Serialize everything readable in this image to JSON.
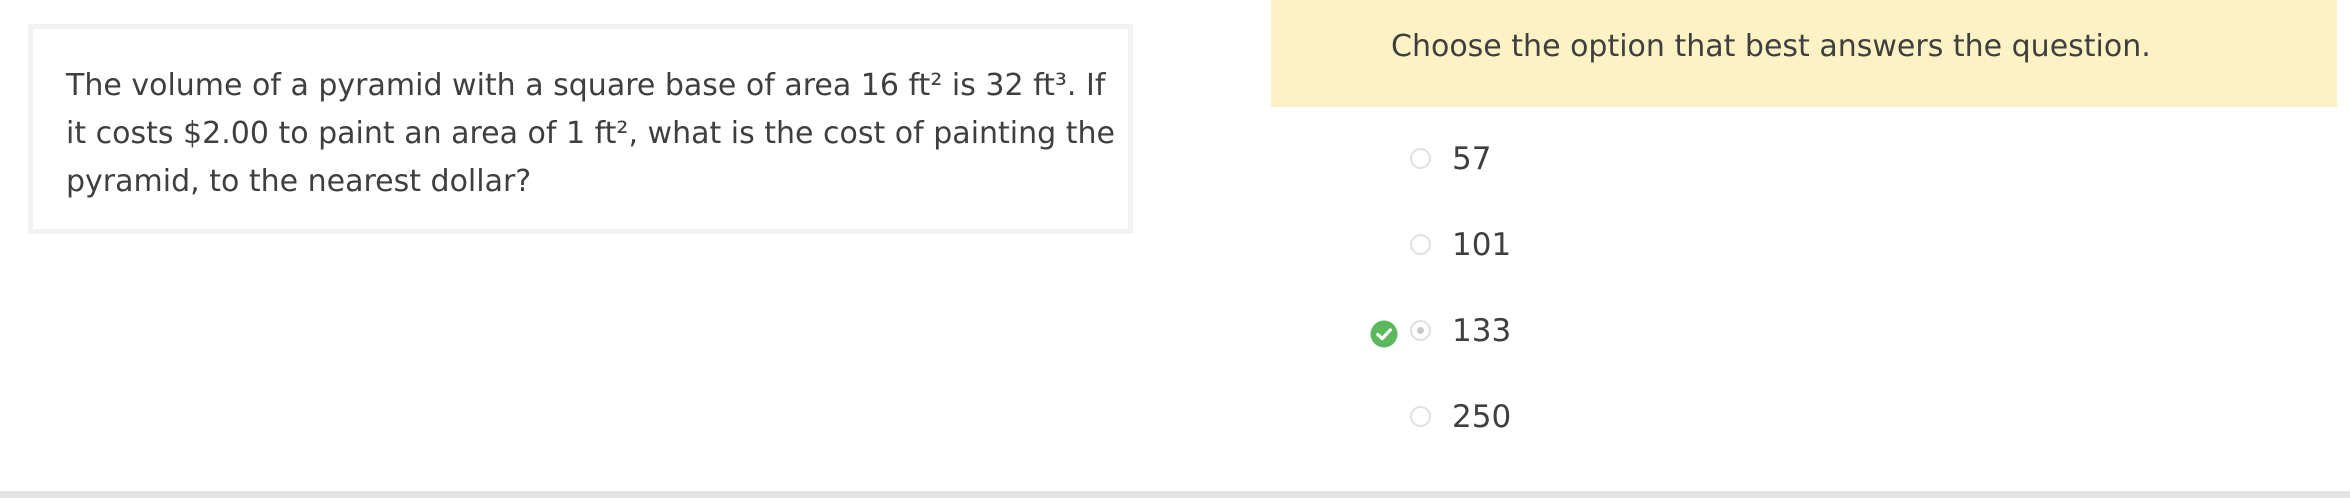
{
  "question": {
    "text": "The volume of a pyramid with a square base of area 16 ft² is 32 ft³. If it costs $2.00 to paint an area of 1 ft², what is the cost of painting the pyramid, to the nearest dollar?"
  },
  "instruction": {
    "text": "Choose the option that best answers the question."
  },
  "options": [
    {
      "label": "57",
      "selected": false,
      "correct": false
    },
    {
      "label": "101",
      "selected": false,
      "correct": false
    },
    {
      "label": "133",
      "selected": true,
      "correct": true
    },
    {
      "label": "250",
      "selected": false,
      "correct": false
    }
  ],
  "icons": {
    "correct_icon": "check-circle-icon",
    "correct_color": "#5cb85c"
  },
  "colors": {
    "banner": "#fdf2c4",
    "text": "#3f3f3f"
  }
}
